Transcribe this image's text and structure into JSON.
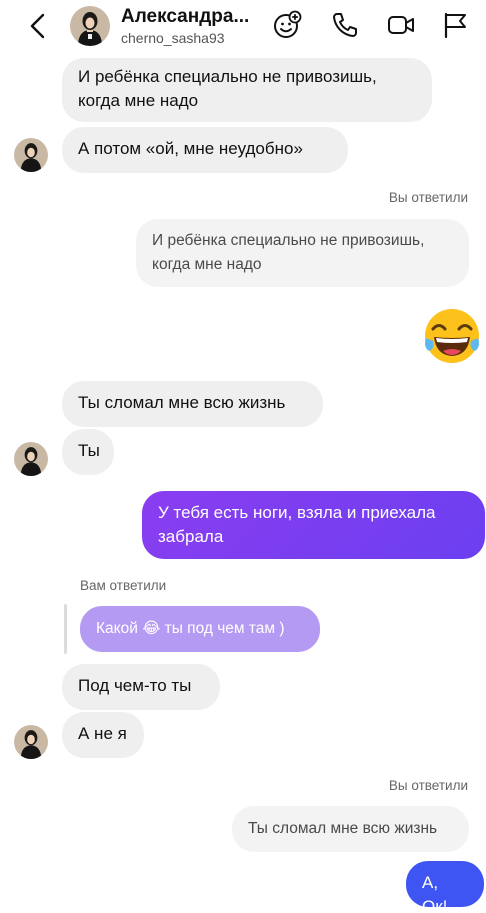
{
  "header": {
    "contact_name": "Александра...",
    "contact_handle": "cherno_sasha93",
    "icons": [
      "back-chevron-icon",
      "add-emoji-icon",
      "phone-icon",
      "video-camera-icon",
      "flag-icon"
    ]
  },
  "messages": {
    "m1": "И ребёнка специально не привозишь, когда мне надо",
    "m2": "А потом «ой, мне неудобно»",
    "reply1_label": "Вы ответили",
    "reply1_quote": "И ребёнка специально не привозишь, когда мне надо",
    "sticker": "😂",
    "m3": "Ты сломал мне всю жизнь",
    "m4": "Ты",
    "m5": "У тебя есть ноги, взяла и приехала забрала",
    "reply2_label": "Вам ответили",
    "reply2_quote_a": "Какой",
    "reply2_quote_emoji": "😂",
    "reply2_quote_b": "ты под чем там )",
    "m6": "Под чем-то ты",
    "m7": "А не я",
    "reply3_label": "Вы ответили",
    "reply3_quote": "Ты сломал мне всю жизнь",
    "m8": "А, Ок!"
  },
  "colors": {
    "outgoing_purple": "#7b3df2",
    "outgoing_blue": "#3f55f3",
    "incoming_gray": "#efefef",
    "reply_purple": "#b49af3"
  }
}
